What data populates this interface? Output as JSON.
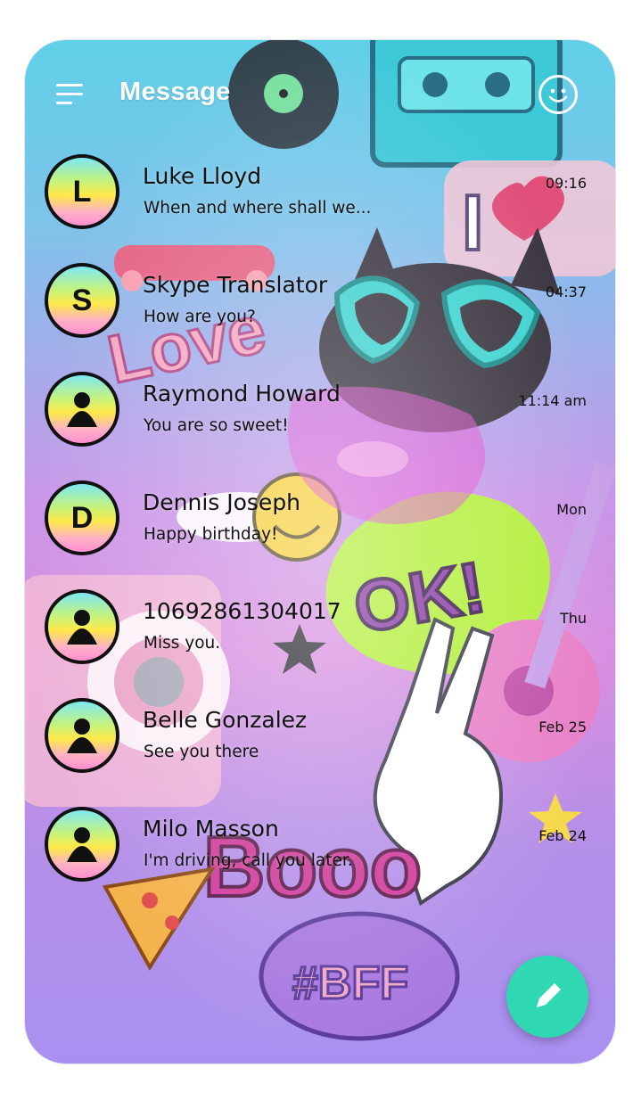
{
  "header": {
    "title": "Message",
    "menu_icon": "hamburger-menu-icon",
    "theme_icon": "smiley-face-icon"
  },
  "conversations": [
    {
      "avatar_letter": "L",
      "avatar_type": "letter",
      "name": "Luke Lloyd",
      "snippet": "When and where shall we...",
      "time": "09:16"
    },
    {
      "avatar_letter": "S",
      "avatar_type": "letter",
      "name": "Skype Translator",
      "snippet": "How are you?",
      "time": "04:37"
    },
    {
      "avatar_letter": "",
      "avatar_type": "person",
      "name": "Raymond Howard",
      "snippet": "You are so sweet!",
      "time": "11:14 am"
    },
    {
      "avatar_letter": "D",
      "avatar_type": "letter",
      "name": "Dennis Joseph",
      "snippet": "Happy birthday!",
      "time": "Mon"
    },
    {
      "avatar_letter": "",
      "avatar_type": "person",
      "name": "10692861304017",
      "snippet": "Miss you.",
      "time": "Thu"
    },
    {
      "avatar_letter": "",
      "avatar_type": "person",
      "name": "Belle Gonzalez",
      "snippet": "See you there",
      "time": "Feb 25"
    },
    {
      "avatar_letter": "",
      "avatar_type": "person",
      "name": "Milo Masson",
      "snippet": "I'm driving, call you later.",
      "time": "Feb 24"
    }
  ],
  "fab": {
    "icon": "pencil-compose-icon"
  },
  "colors": {
    "fab": "#2fd7b2",
    "avatar_gradient": [
      "#7ee8f2",
      "#ffe94a",
      "#ff8fd0"
    ],
    "title": "#ffffff"
  }
}
